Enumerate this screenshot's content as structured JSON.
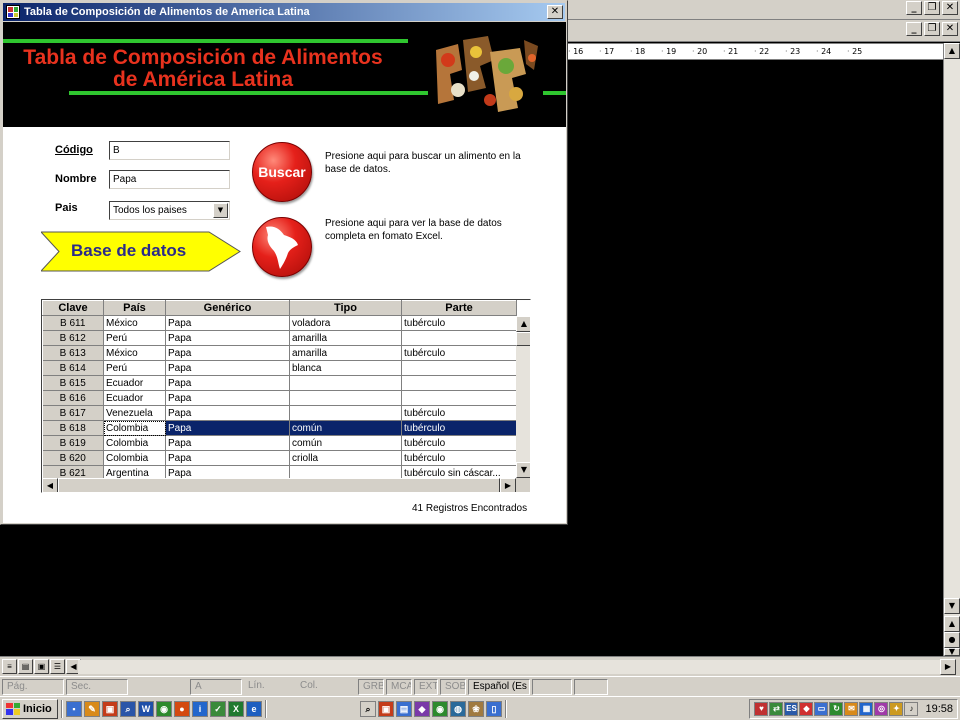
{
  "app_window": {
    "title": "Tabla de Composición de Alimentos de America Latina",
    "close_glyph": "✕"
  },
  "banner": {
    "title_line1": "Tabla de Composición de Alimentos",
    "title_line2": "de América Latina",
    "title_color": "#e8321e",
    "line_color": "#2fc62f"
  },
  "search_form": {
    "codigo_label": "Código",
    "codigo_value": "B",
    "nombre_label": "Nombre",
    "nombre_value": "Papa",
    "pais_label": "Pais",
    "pais_value": "Todos los paises"
  },
  "buscar_button": {
    "label": "Buscar",
    "hint": "Presione aqui para buscar un alimento en la base de datos."
  },
  "excel_button": {
    "icon": "map-icon",
    "hint": "Presione aqui para ver la base de datos completa en fomato Excel."
  },
  "callout": {
    "label": "Base de datos",
    "fill_color": "#ffff00"
  },
  "results_grid": {
    "columns": [
      "Clave",
      "País",
      "Genérico",
      "Tipo",
      "Parte"
    ],
    "rows": [
      {
        "clave": "B 611",
        "pais": "México",
        "generico": "Papa",
        "tipo": "voladora",
        "parte": "tubérculo"
      },
      {
        "clave": "B 612",
        "pais": "Perú",
        "generico": "Papa",
        "tipo": "amarilla",
        "parte": ""
      },
      {
        "clave": "B 613",
        "pais": "México",
        "generico": "Papa",
        "tipo": "amarilla",
        "parte": "tubérculo"
      },
      {
        "clave": "B 614",
        "pais": "Perú",
        "generico": "Papa",
        "tipo": "blanca",
        "parte": ""
      },
      {
        "clave": "B 615",
        "pais": "Ecuador",
        "generico": "Papa",
        "tipo": "",
        "parte": ""
      },
      {
        "clave": "B 616",
        "pais": "Ecuador",
        "generico": "Papa",
        "tipo": "",
        "parte": ""
      },
      {
        "clave": "B 617",
        "pais": "Venezuela",
        "generico": "Papa",
        "tipo": "",
        "parte": "tubérculo"
      },
      {
        "clave": "B 618",
        "pais": "Colombia",
        "generico": "Papa",
        "tipo": "común",
        "parte": "tubérculo",
        "selected": true
      },
      {
        "clave": "B 619",
        "pais": "Colombia",
        "generico": "Papa",
        "tipo": "común",
        "parte": "tubérculo"
      },
      {
        "clave": "B 620",
        "pais": "Colombia",
        "generico": "Papa",
        "tipo": "criolla",
        "parte": "tubérculo"
      },
      {
        "clave": "B 621",
        "pais": "Argentina",
        "generico": "Papa",
        "tipo": "",
        "parte": "tubérculo sin cáscar..."
      }
    ],
    "selection_color": "#0a246a"
  },
  "records_found": "41  Registros Encontrados",
  "word_window": {
    "ruler_ticks": [
      "16",
      "17",
      "18",
      "19",
      "20",
      "21",
      "22",
      "23",
      "24",
      "25"
    ],
    "status_cells": [
      "Pág.",
      "Sec.",
      "A",
      "Lín.",
      "Col.",
      "GRB",
      "MCA",
      "EXT",
      "SOB",
      "Español (Es"
    ]
  },
  "taskbar": {
    "start_label": "Inicio",
    "clock": "19:58"
  }
}
